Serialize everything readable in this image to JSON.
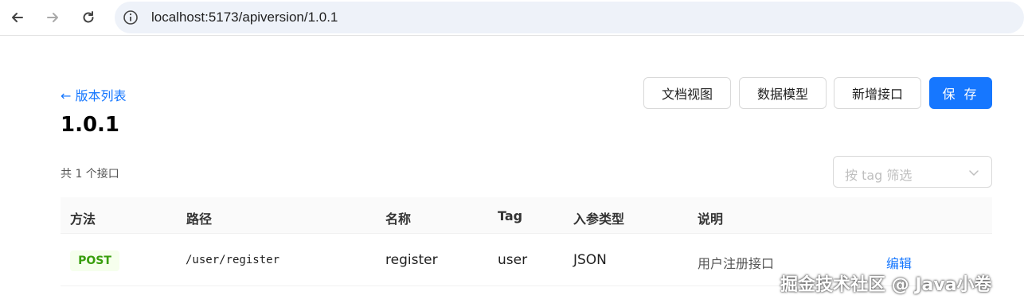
{
  "browser": {
    "url": "localhost:5173/apiversion/1.0.1"
  },
  "header": {
    "back_label": "← 版本列表",
    "title": "1.0.1",
    "buttons": {
      "doc_view": "文档视图",
      "data_model": "数据模型",
      "add_api": "新增接口",
      "save": "保 存"
    }
  },
  "toolbar": {
    "count_text": "共 1 个接口",
    "tag_filter_placeholder": "按 tag 筛选"
  },
  "table": {
    "columns": [
      "方法",
      "路径",
      "名称",
      "Tag",
      "入参类型",
      "说明"
    ],
    "rows": [
      {
        "method": "POST",
        "path": "/user/register",
        "name": "register",
        "tag": "user",
        "param_type": "JSON",
        "description": "用户注册接口",
        "action": "编辑"
      }
    ]
  },
  "watermark": "掘金技术社区 @ Java小卷",
  "colors": {
    "primary": "#1677ff",
    "post_badge_bg": "#f6ffed",
    "post_badge_text": "#389e0d"
  }
}
